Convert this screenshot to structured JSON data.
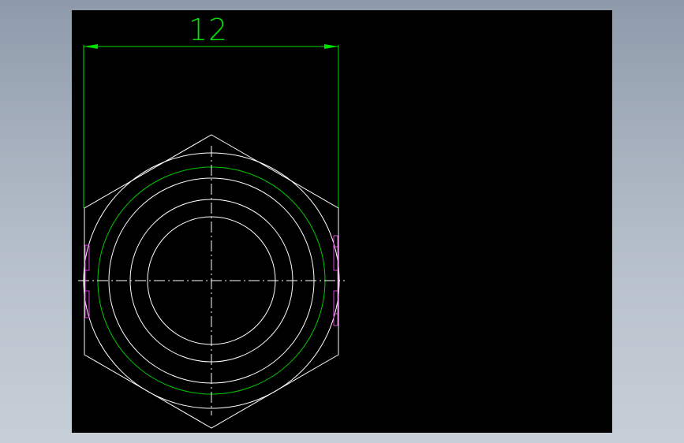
{
  "dimension": {
    "value": "12"
  },
  "colors": {
    "background": "#000000",
    "frame": "#aeb8c4",
    "geometry": "#ffffff",
    "dimension": "#00e000",
    "thread_circle": "#00c800",
    "hidden_marks": "#e040e0"
  }
}
